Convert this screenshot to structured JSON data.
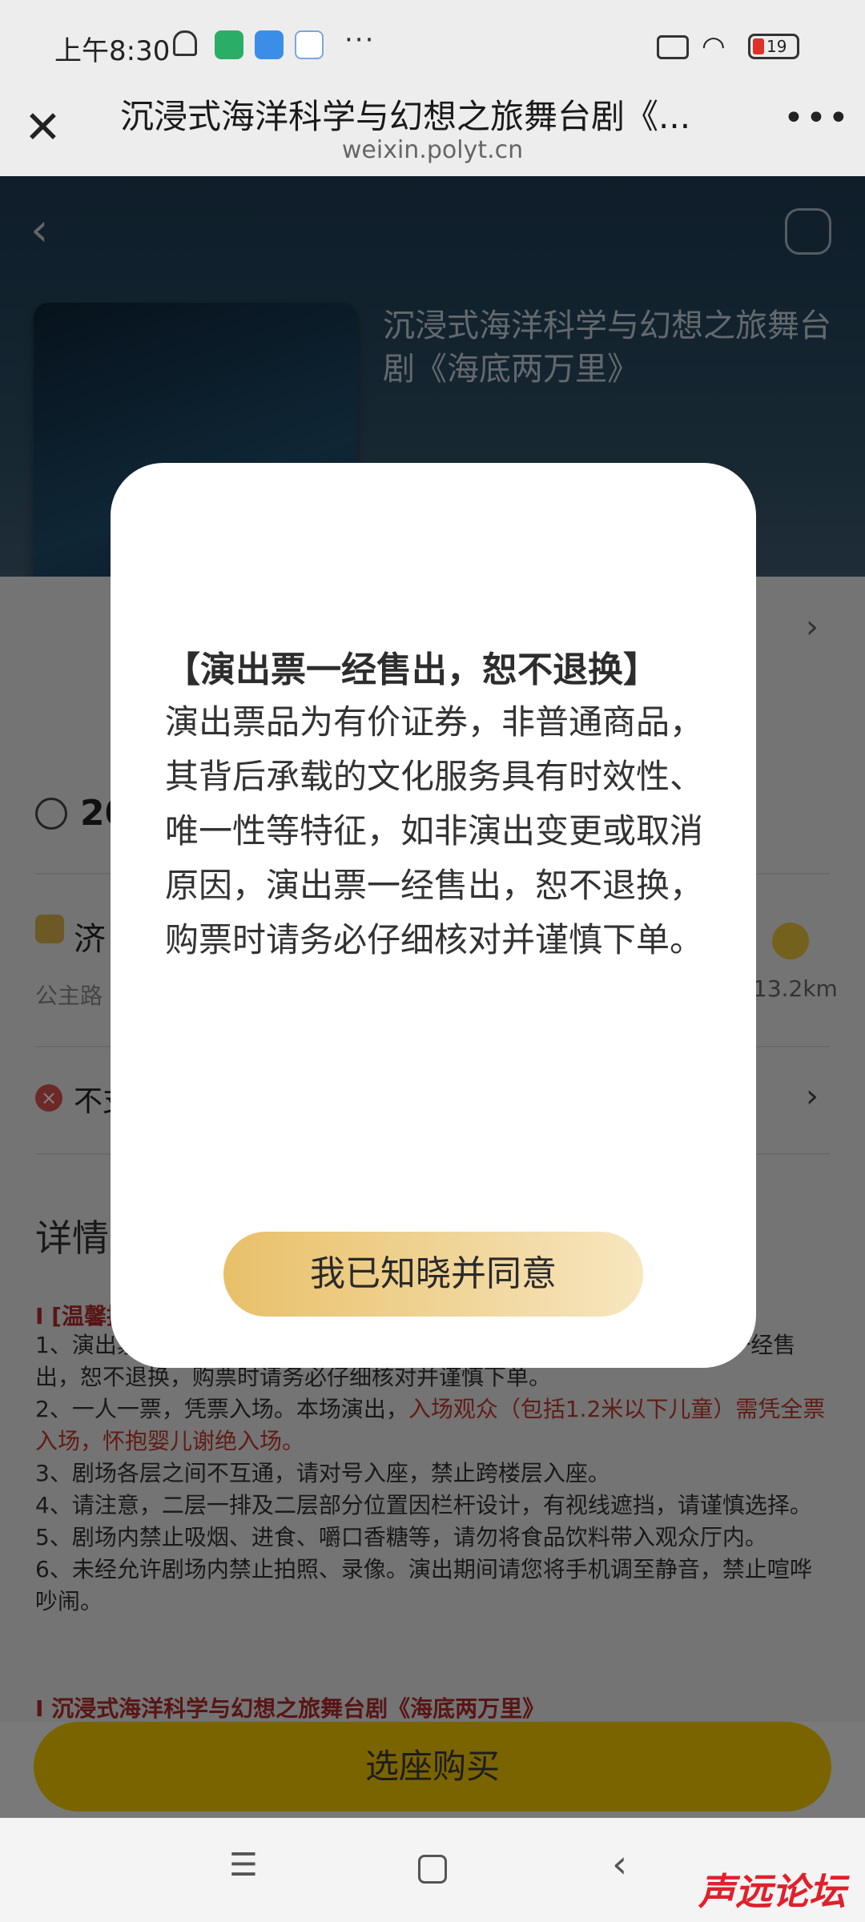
{
  "status_bar": {
    "time": "上午8:30",
    "more": "···",
    "battery": "19",
    "wifi_icon": "wifi-icon",
    "battery_color": "#e0302a"
  },
  "browser": {
    "title": "沉浸式海洋科学与幻想之旅舞台剧《...",
    "domain": "weixin.polyt.cn",
    "close_icon": "close-icon",
    "menu_icon": "more-dots-icon"
  },
  "show": {
    "title": "沉浸式海洋科学与幻想之旅舞台剧《海底两万里》",
    "time_partial": "20",
    "venue_partial": "济",
    "address_partial": "公主路",
    "distance": "13.2km",
    "refund_partial": "不支",
    "details_label": "详情",
    "tip_head": "I [温馨提",
    "notice_lines": [
      "1、演出票... 效性、唯一性等特征，如非演出变更或取消原因，演出票一经售出，恕不退换，购票时请务必仔细核对并谨慎下单。",
      "2、一人一票，凭票入场。本场演出，",
      "入场观众（包括1.2米以下儿童）需凭全票入场，怀抱婴儿谢绝入场。",
      "3、剧场各层之间不互通，请对号入座，禁止跨楼层入座。",
      "4、请注意，二层一排及二层部分位置因栏杆设计，有视线遮挡，请谨慎选择。",
      "5、剧场内禁止吸烟、进食、嚼口香糖等，请勿将食品饮料带入观众厅内。",
      "6、未经允许剧场内禁止拍照、录像。演出期间请您将手机调至静音，禁止喧哗吵闹。"
    ],
    "notice_head2": "I 沉浸式海洋科学与幻想之旅舞台剧《海底两万里》"
  },
  "buy_button": {
    "label": "选座购买",
    "color": "#f5c800"
  },
  "modal": {
    "title": "【演出票一经售出，恕不退换】",
    "body": "演出票品为有价证券，非普通商品，其背后承载的文化服务具有时效性、唯一性等特征，如非演出变更或取消原因，演出票一经售出，恕不退换，购票时请务必仔细核对并谨慎下单。",
    "agree_label": "我已知晓并同意"
  },
  "nav": {
    "menu_icon": "menu-icon",
    "home_icon": "home-icon",
    "back_icon": "back-icon"
  },
  "watermark": "声远论坛"
}
